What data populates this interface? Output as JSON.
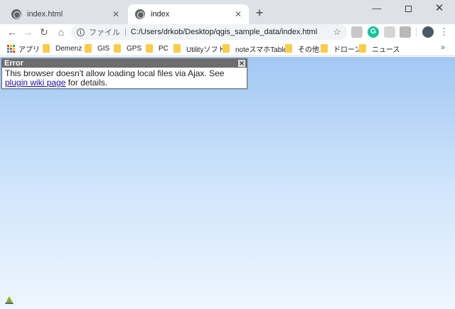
{
  "tabs": [
    {
      "title": "index.html",
      "active": false
    },
    {
      "title": "index",
      "active": true
    }
  ],
  "new_tab_label": "+",
  "window_controls": {
    "minimize": "—",
    "close": "✕"
  },
  "omnibox": {
    "scheme_label": "ファイル",
    "url": "C:/Users/drkob/Desktop/qgis_sample_data/index.html"
  },
  "bookmarks": [
    {
      "label": "アプリ",
      "icon": "apps-icon"
    },
    {
      "label": "Demenz",
      "icon": "folder-icon"
    },
    {
      "label": "GIS",
      "icon": "folder-icon"
    },
    {
      "label": "GPS",
      "icon": "folder-icon"
    },
    {
      "label": "PC",
      "icon": "folder-icon"
    },
    {
      "label": "Utilityソフト",
      "icon": "folder-icon"
    },
    {
      "label": "noteスマホTablet",
      "icon": "folder-icon"
    },
    {
      "label": "その他",
      "icon": "folder-icon"
    },
    {
      "label": "ドローン",
      "icon": "folder-icon"
    },
    {
      "label": "ニュース",
      "icon": "folder-icon"
    }
  ],
  "bookmarks_more": "»",
  "error_dialog": {
    "title": "Error",
    "message_before": "This browser doesn't allow loading local files via Ajax. See ",
    "link_text": "plugin wiki page",
    "message_after": " for details."
  },
  "colors": {
    "tabstrip_bg": "#dee1e6",
    "page_gradient_top": "#a2c8f3",
    "page_gradient_bottom": "#eef6fe",
    "dialog_header": "#6d6d6d",
    "link": "#1a0dab"
  }
}
